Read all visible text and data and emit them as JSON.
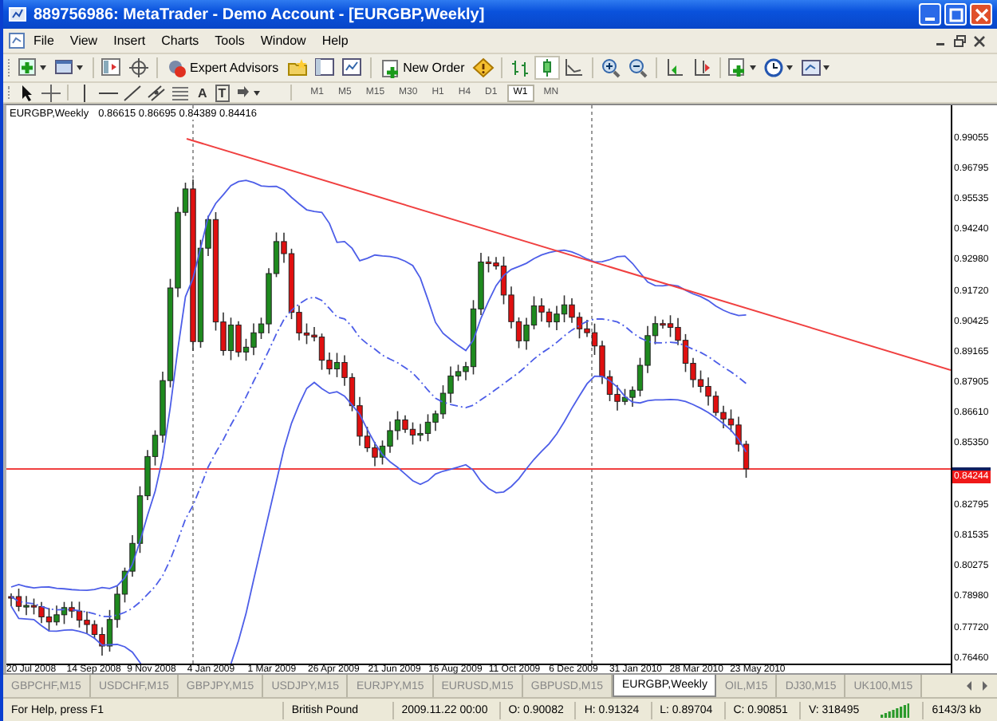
{
  "window": {
    "title": "889756986: MetaTrader - Demo Account - [EURGBP,Weekly]"
  },
  "menu": [
    "File",
    "View",
    "Insert",
    "Charts",
    "Tools",
    "Window",
    "Help"
  ],
  "toolbar": {
    "expert_advisors": "Expert Advisors",
    "new_order": "New Order"
  },
  "drawing_tools": {
    "text_tool": "A",
    "label_tool": "T"
  },
  "periods": [
    {
      "label": "M1",
      "selected": false
    },
    {
      "label": "M5",
      "selected": false
    },
    {
      "label": "M15",
      "selected": false
    },
    {
      "label": "M30",
      "selected": false
    },
    {
      "label": "H1",
      "selected": false
    },
    {
      "label": "H4",
      "selected": false
    },
    {
      "label": "D1",
      "selected": false
    },
    {
      "label": "W1",
      "selected": true
    },
    {
      "label": "MN",
      "selected": false
    }
  ],
  "chart": {
    "symbol": "EURGBP,Weekly",
    "ohlc": "0.86615 0.86695 0.84389 0.84416",
    "price_labels": [
      {
        "text": "0.99055",
        "kind": "tick"
      },
      {
        "text": "0.96795",
        "kind": "tick"
      },
      {
        "text": "0.95535",
        "kind": "tick"
      },
      {
        "text": "0.94240",
        "kind": "tick"
      },
      {
        "text": "0.92980",
        "kind": "tick"
      },
      {
        "text": "0.91720",
        "kind": "tick"
      },
      {
        "text": "0.90425",
        "kind": "tick"
      },
      {
        "text": "0.89165",
        "kind": "tick"
      },
      {
        "text": "0.87905",
        "kind": "tick"
      },
      {
        "text": "0.86610",
        "kind": "tick"
      },
      {
        "text": "0.85350",
        "kind": "tick"
      },
      {
        "text": "0.84244",
        "kind": "current"
      },
      {
        "text": "0.82795",
        "kind": "tick"
      },
      {
        "text": "0.81535",
        "kind": "tick"
      },
      {
        "text": "0.80275",
        "kind": "tick"
      },
      {
        "text": "0.78980",
        "kind": "tick"
      },
      {
        "text": "0.77720",
        "kind": "tick"
      },
      {
        "text": "0.76460",
        "kind": "tick"
      }
    ],
    "date_labels": [
      "20 Jul 2008",
      "14 Sep 2008",
      "9 Nov 2008",
      "4 Jan 2009",
      "1 Mar 2009",
      "26 Apr 2009",
      "21 Jun 2009",
      "16 Aug 2009",
      "11 Oct 2009",
      "6 Dec 2009",
      "31 Jan 2010",
      "28 Mar 2010",
      "23 May 2010"
    ]
  },
  "tabs": [
    {
      "label": "GBPCHF,M15",
      "selected": false
    },
    {
      "label": "USDCHF,M15",
      "selected": false
    },
    {
      "label": "GBPJPY,M15",
      "selected": false
    },
    {
      "label": "USDJPY,M15",
      "selected": false
    },
    {
      "label": "EURJPY,M15",
      "selected": false
    },
    {
      "label": "EURUSD,M15",
      "selected": false
    },
    {
      "label": "GBPUSD,M15",
      "selected": false
    },
    {
      "label": "EURGBP,Weekly",
      "selected": true
    },
    {
      "label": "OIL,M15",
      "selected": false
    },
    {
      "label": "DJ30,M15",
      "selected": false
    },
    {
      "label": "UK100,M15",
      "selected": false
    }
  ],
  "status_bar": {
    "help": "For Help, press F1",
    "symbol": "British Pound",
    "time": "2009.11.22 00:00",
    "open": "O: 0.90082",
    "high": "H: 0.91324",
    "low": "L: 0.89704",
    "close": "C: 0.90851",
    "volume": "V: 318495",
    "traffic": "6143/3 kb"
  }
}
